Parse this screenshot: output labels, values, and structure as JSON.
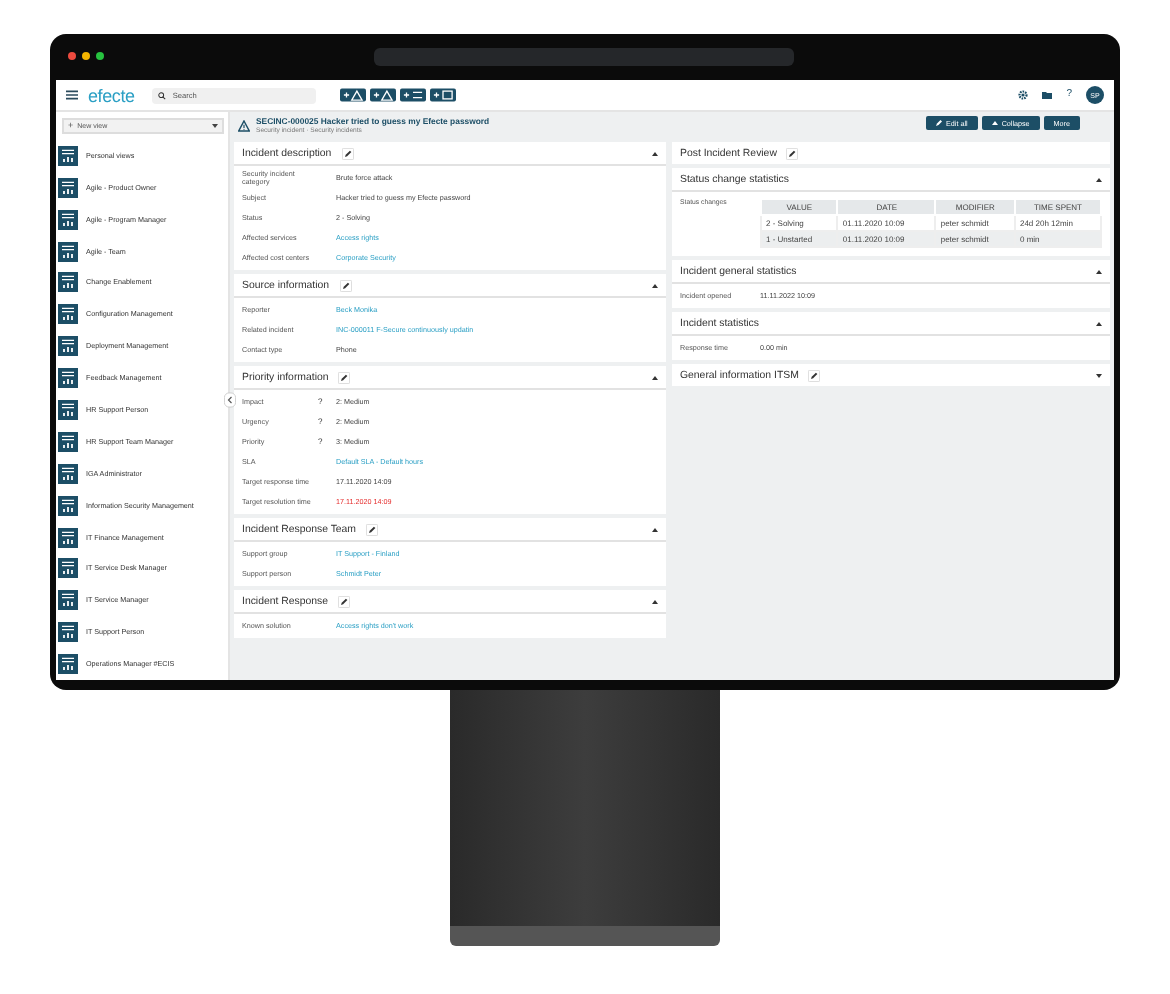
{
  "header": {
    "logo": "efecte",
    "search": {
      "placeholder": "Search"
    },
    "help": "?",
    "avatar": "SP"
  },
  "sidebar": {
    "new_view": {
      "icon": "+",
      "label": "New view"
    },
    "items": [
      {
        "label": "Personal views"
      },
      {
        "label": "Agile - Product Owner"
      },
      {
        "label": "Agile - Program Manager"
      },
      {
        "label": "Agile - Team"
      },
      {
        "label": "Change Enablement"
      },
      {
        "label": "Configuration Management"
      },
      {
        "label": "Deployment Management"
      },
      {
        "label": "Feedback Management"
      },
      {
        "label": "HR Support Person"
      },
      {
        "label": "HR Support Team Manager"
      },
      {
        "label": "IGA Administrator"
      },
      {
        "label": "Information Security Management"
      },
      {
        "label": "IT Finance Management"
      },
      {
        "label": "IT Service Desk Manager"
      },
      {
        "label": "IT Service Manager"
      },
      {
        "label": "IT Support Person"
      },
      {
        "label": "Operations Manager #ECIS"
      }
    ]
  },
  "record": {
    "title": "SECINC-000025 Hacker tried to guess my Efecte password",
    "subtitle": "Security incident · Security incidents"
  },
  "actions": [
    {
      "label": "Edit all",
      "kind": "edit"
    },
    {
      "label": "Collapse",
      "kind": "collapse"
    },
    {
      "label": "More",
      "kind": "plain"
    }
  ],
  "left_cards": [
    {
      "title": "Incident description",
      "editable": true,
      "expanded": true,
      "fields": [
        {
          "label": "Security incident category",
          "value": "Brute force attack",
          "kind": "text"
        },
        {
          "label": "Subject",
          "value": "Hacker tried to guess my Efecte password",
          "kind": "text"
        },
        {
          "label": "Status",
          "value": "2 - Solving",
          "kind": "text"
        },
        {
          "label": "Affected services",
          "value": "Access rights",
          "kind": "link"
        },
        {
          "label": "Affected cost centers",
          "value": "Corporate Security",
          "kind": "link"
        }
      ]
    },
    {
      "title": "Source information",
      "editable": true,
      "expanded": true,
      "fields": [
        {
          "label": "Reporter",
          "value": "Beck Monika",
          "kind": "link"
        },
        {
          "label": "Related incident",
          "value": "INC-000011 F-Secure continuously updatin",
          "kind": "link"
        },
        {
          "label": "Contact type",
          "value": "Phone",
          "kind": "text"
        }
      ]
    },
    {
      "title": "Priority information",
      "editable": true,
      "expanded": true,
      "fields": [
        {
          "label": "Impact",
          "help": "?",
          "value": "2: Medium",
          "kind": "text"
        },
        {
          "label": "Urgency",
          "help": "?",
          "value": "2: Medium",
          "kind": "text"
        },
        {
          "label": "Priority",
          "help": "?",
          "value": "3: Medium",
          "kind": "text"
        },
        {
          "label": "SLA",
          "value": "Default SLA - Default hours",
          "kind": "link"
        },
        {
          "label": "Target response time",
          "value": "17.11.2020 14:09",
          "kind": "text"
        },
        {
          "label": "Target resolution time",
          "value": "17.11.2020 14:09",
          "kind": "overdue"
        }
      ]
    },
    {
      "title": "Incident Response Team",
      "editable": true,
      "expanded": true,
      "fields": [
        {
          "label": "Support group",
          "value": "IT Support - Finland",
          "kind": "link"
        },
        {
          "label": "Support person",
          "value": "Schmidt Peter",
          "kind": "link"
        }
      ]
    },
    {
      "title": "Incident Response",
      "editable": true,
      "expanded": true,
      "fields": [
        {
          "label": "Known solution",
          "value": "Access rights don't work",
          "kind": "link"
        }
      ]
    }
  ],
  "right_cards": [
    {
      "title": "Post Incident Review",
      "editable": true
    },
    {
      "title": "Status change statistics",
      "editable": false,
      "expanded": true,
      "table": {
        "label": "Status changes",
        "columns": [
          "VALUE",
          "DATE",
          "MODIFIER",
          "TIME SPENT"
        ],
        "rows": [
          [
            "2 - Solving",
            "01.11.2020 10:09",
            "peter schmidt",
            "24d 20h 12min"
          ],
          [
            "1 - Unstarted",
            "01.11.2020 10:09",
            "peter schmidt",
            "0 min"
          ]
        ]
      }
    },
    {
      "title": "Incident general statistics",
      "editable": false,
      "expanded": true,
      "fields": [
        {
          "label": "Incident opened",
          "value": "11.11.2022 10:09",
          "kind": "text"
        }
      ]
    },
    {
      "title": "Incident statistics",
      "editable": false,
      "expanded": true,
      "fields": [
        {
          "label": "Response time",
          "value": "0.00 min",
          "kind": "text"
        }
      ]
    },
    {
      "title": "General information ITSM",
      "editable": true,
      "expanded": false
    }
  ]
}
